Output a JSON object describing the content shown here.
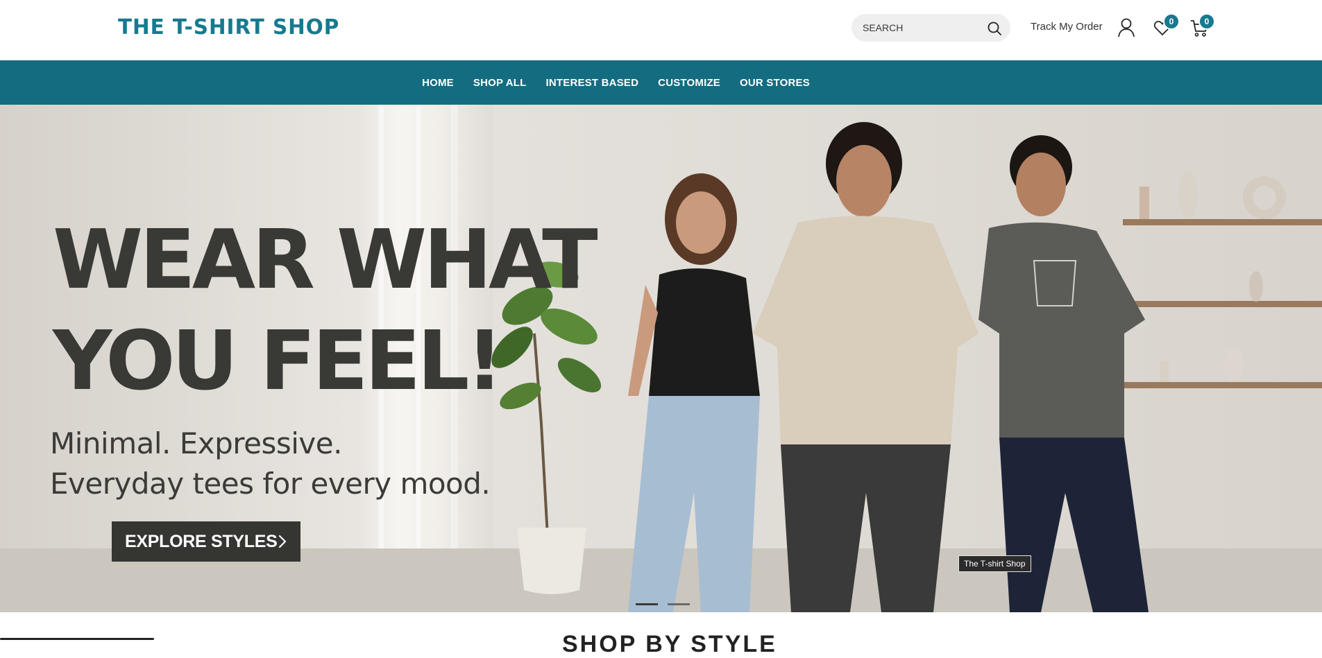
{
  "brand": {
    "logo_text": "THE T-SHIRT SHOP",
    "color": "#177a8f"
  },
  "header": {
    "search_placeholder": "SEARCH",
    "track_order": "Track My Order",
    "wishlist_count": "0",
    "cart_count": "0"
  },
  "nav": {
    "background": "#146c80",
    "items": [
      "HOME",
      "SHOP ALL",
      "INTEREST BASED",
      "CUSTOMIZE",
      "OUR STORES"
    ]
  },
  "hero": {
    "headline_line1": "WEAR WHAT",
    "headline_line2": "YOU FEEL!",
    "sub_line1": "Minimal. Expressive.",
    "sub_line2": "Everyday tees for every mood.",
    "cta_label": "EXPLORE STYLES",
    "image_tag": "The T-shirt Shop",
    "slide_active": 1,
    "slide_count": 2
  },
  "section": {
    "title_partial": "SHOP BY STYLE"
  }
}
